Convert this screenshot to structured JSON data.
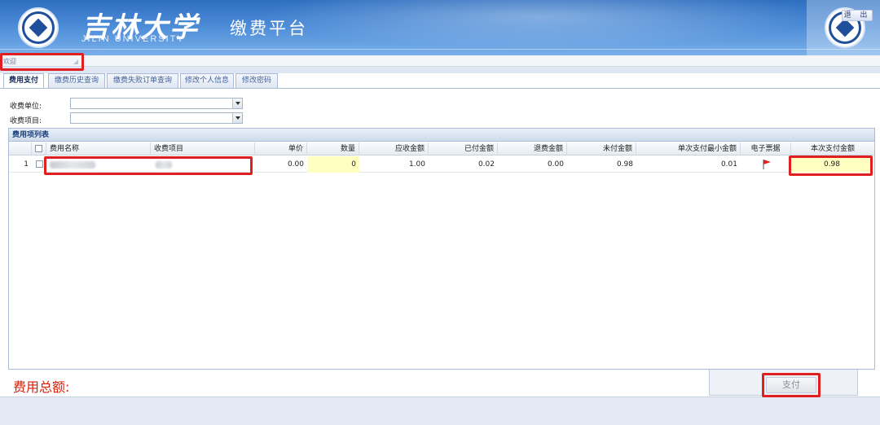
{
  "header": {
    "logo_cn": "吉林大学",
    "logo_en": "JILIN UNIVERSITY",
    "system_title": "缴费平台",
    "logout_label": "退 出"
  },
  "welcome": {
    "text": "欢迎"
  },
  "tabs": [
    {
      "label": "费用支付",
      "active": true
    },
    {
      "label": "缴费历史查询"
    },
    {
      "label": "缴费失败订单查询"
    },
    {
      "label": "修改个人信息"
    },
    {
      "label": "修改密码"
    }
  ],
  "form": {
    "unit_label": "收费单位:",
    "unit_value": "",
    "item_label": "收费项目:",
    "item_value": ""
  },
  "grid": {
    "title": "费用项列表",
    "columns": [
      "费用名称",
      "收费项目",
      "单价",
      "数量",
      "应收金额",
      "已付金额",
      "退费金额",
      "未付金额",
      "单次支付最小金额",
      "电子票据",
      "本次支付金额"
    ],
    "rows": [
      {
        "index": "1",
        "fee_name": "",
        "fee_item": "",
        "unit_price": "0.00",
        "quantity": "0",
        "receivable": "1.00",
        "paid": "0.02",
        "refund": "0.00",
        "unpaid": "0.98",
        "min_payment": "0.01",
        "e_invoice_icon": "red-flag-icon",
        "this_payment": "0.98"
      }
    ]
  },
  "footer": {
    "total_label": "费用总额:",
    "pay_label": "支付"
  },
  "colors": {
    "header_blue": "#2f6fc0",
    "highlight_yellow": "#ffffc2",
    "annotation_red": "#e02020",
    "total_red": "#d81e06"
  }
}
